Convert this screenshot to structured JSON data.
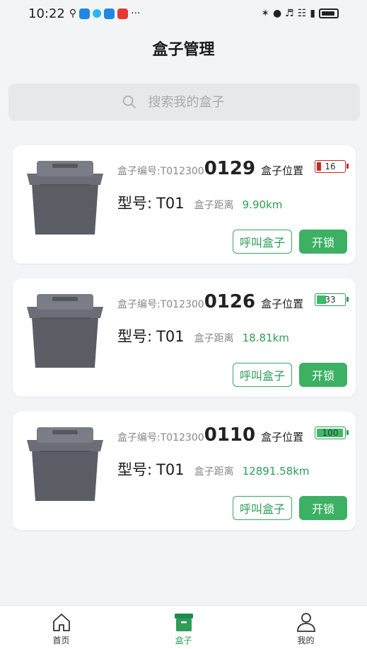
{
  "status_bar": {
    "time": "10:22",
    "more": "···"
  },
  "header": {
    "title": "盒子管理"
  },
  "search": {
    "placeholder": "搜索我的盒子"
  },
  "boxes": [
    {
      "code_prefix": "盒子编号:T012300",
      "code_suffix": "0129",
      "location_label": "盒子位置",
      "battery": 16,
      "battery_text": "16",
      "model_label": "型号:",
      "model": "T01",
      "distance_label": "盒子距离",
      "distance": "9.90km",
      "call_label": "呼叫盒子",
      "unlock_label": "开锁"
    },
    {
      "code_prefix": "盒子编号:T012300",
      "code_suffix": "0126",
      "location_label": "盒子位置",
      "battery": 33,
      "battery_text": "33",
      "model_label": "型号:",
      "model": "T01",
      "distance_label": "盒子距离",
      "distance": "18.81km",
      "call_label": "呼叫盒子",
      "unlock_label": "开锁"
    },
    {
      "code_prefix": "盒子编号:T012300",
      "code_suffix": "0110",
      "location_label": "盒子位置",
      "battery": 100,
      "battery_text": "100",
      "model_label": "型号:",
      "model": "T01",
      "distance_label": "盒子距离",
      "distance": "12891.58km",
      "call_label": "呼叫盒子",
      "unlock_label": "开锁"
    }
  ],
  "tabs": [
    {
      "label": "首页",
      "icon": "home-icon",
      "active": false
    },
    {
      "label": "盒子",
      "icon": "box-icon",
      "active": true
    },
    {
      "label": "我的",
      "icon": "user-icon",
      "active": false
    }
  ],
  "colors": {
    "accent": "#3cb063",
    "battery_low": "#c62828",
    "battery_ok": "#3cba68"
  }
}
